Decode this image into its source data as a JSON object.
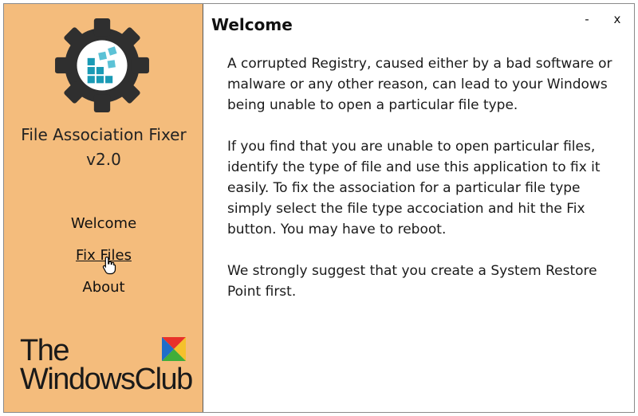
{
  "sidebar": {
    "app_name_line1": "File Association Fixer",
    "app_name_line2": "v2.0",
    "nav": {
      "welcome": "Welcome",
      "fix_files": "Fix Files",
      "about": "About"
    },
    "brand": {
      "line1": "The",
      "line2": "WindowsClub"
    },
    "icons": {
      "logo": "gear-icon",
      "cursor": "hand-pointer-icon",
      "brand_mark": "windows-club-mark-icon"
    }
  },
  "window_controls": {
    "minimize": "-",
    "close": "x"
  },
  "main": {
    "title": "Welcome",
    "paragraphs": [
      "A corrupted Registry, caused either by a bad software or malware or any other reason, can lead to your Windows being unable to open a particular file type.",
      "If you find that you are unable to open particular files, identify the type of file and use this application to fix it easily. To fix the association for a particular file type simply select the file type accociation and hit the Fix button. You may have to reboot.",
      "We strongly suggest that you create a System Restore Point first."
    ]
  },
  "colors": {
    "sidebar_bg": "#f4bc7c",
    "gear": "#2f2f2f",
    "tile": "#1a9ab5",
    "tile_light": "#5cc2d6",
    "mark_red": "#e8312a",
    "mark_blue": "#1f6ec8",
    "mark_green": "#3fae3a",
    "mark_yellow": "#f5c12b"
  }
}
